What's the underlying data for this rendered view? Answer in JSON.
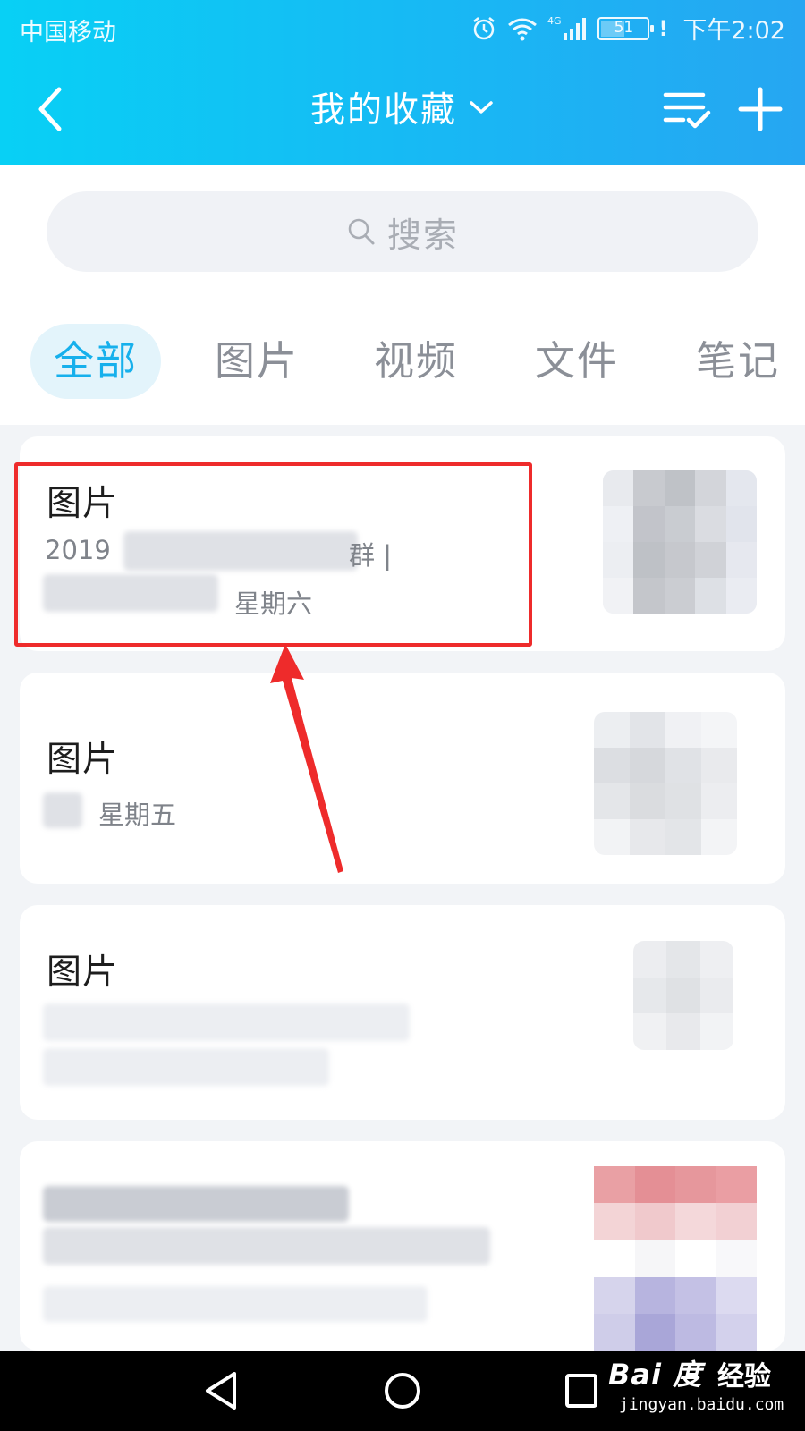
{
  "status_bar": {
    "carrier": "中国移动",
    "network": "4G",
    "battery": "51",
    "time": "下午2:02",
    "icons": [
      "alarm-icon",
      "wifi-icon",
      "signal-icon",
      "battery-icon"
    ]
  },
  "nav": {
    "title": "我的收藏",
    "icons": [
      "back-icon",
      "chevron-down-icon",
      "manage-list-icon",
      "add-icon"
    ]
  },
  "search": {
    "placeholder": "搜索",
    "icon": "search-icon"
  },
  "tabs": [
    {
      "label": "全部",
      "active": true
    },
    {
      "label": "图片",
      "active": false
    },
    {
      "label": "视频",
      "active": false
    },
    {
      "label": "文件",
      "active": false
    },
    {
      "label": "笔记",
      "active": false
    }
  ],
  "favorites": [
    {
      "title": "图片",
      "meta_prefix": "2019",
      "meta_suffix": "群 |",
      "day": "星期六"
    },
    {
      "title": "图片",
      "day": "星期五"
    },
    {
      "title": "图片"
    },
    {
      "title": ""
    }
  ],
  "annotation": {
    "highlight_color": "#ee2b2b"
  },
  "colors": {
    "header_gradient": [
      "#08d0f5",
      "#26a6f2"
    ],
    "accent": "#16b0ec",
    "tab_active_bg": "#e3f4fb"
  },
  "system_nav": {
    "icons": [
      "back-triangle-icon",
      "home-circle-icon",
      "recents-square-icon"
    ]
  },
  "watermark": {
    "logo": "Bai 度",
    "label": "经验",
    "url": "jingyan.baidu.com"
  }
}
